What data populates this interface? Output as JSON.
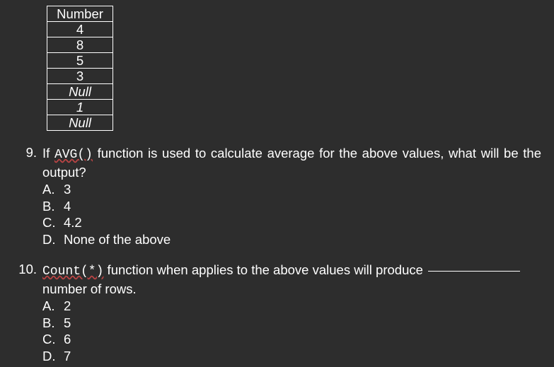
{
  "table": {
    "header": "Number",
    "rows": [
      "4",
      "8",
      "5",
      "3",
      "Null",
      "1",
      "Null"
    ],
    "italic_rows": [
      4,
      5,
      6
    ]
  },
  "questions": [
    {
      "number": "9.",
      "stem_pre": "If ",
      "code": "AVG()",
      "stem_post": " function is used to calculate average for the above values, what will be the output?",
      "options": [
        {
          "letter": "A.",
          "text": "3"
        },
        {
          "letter": "B.",
          "text": "4"
        },
        {
          "letter": "C.",
          "text": "4.2"
        },
        {
          "letter": "D.",
          "text": "None of the above"
        }
      ]
    },
    {
      "number": "10.",
      "code": "Count(*)",
      "stem_post_a": " function when applies to the above values will produce ",
      "stem_post_b": " number of rows.",
      "options": [
        {
          "letter": "A.",
          "text": "2"
        },
        {
          "letter": "B.",
          "text": "5"
        },
        {
          "letter": "C.",
          "text": "6"
        },
        {
          "letter": "D.",
          "text": "7"
        }
      ]
    }
  ]
}
